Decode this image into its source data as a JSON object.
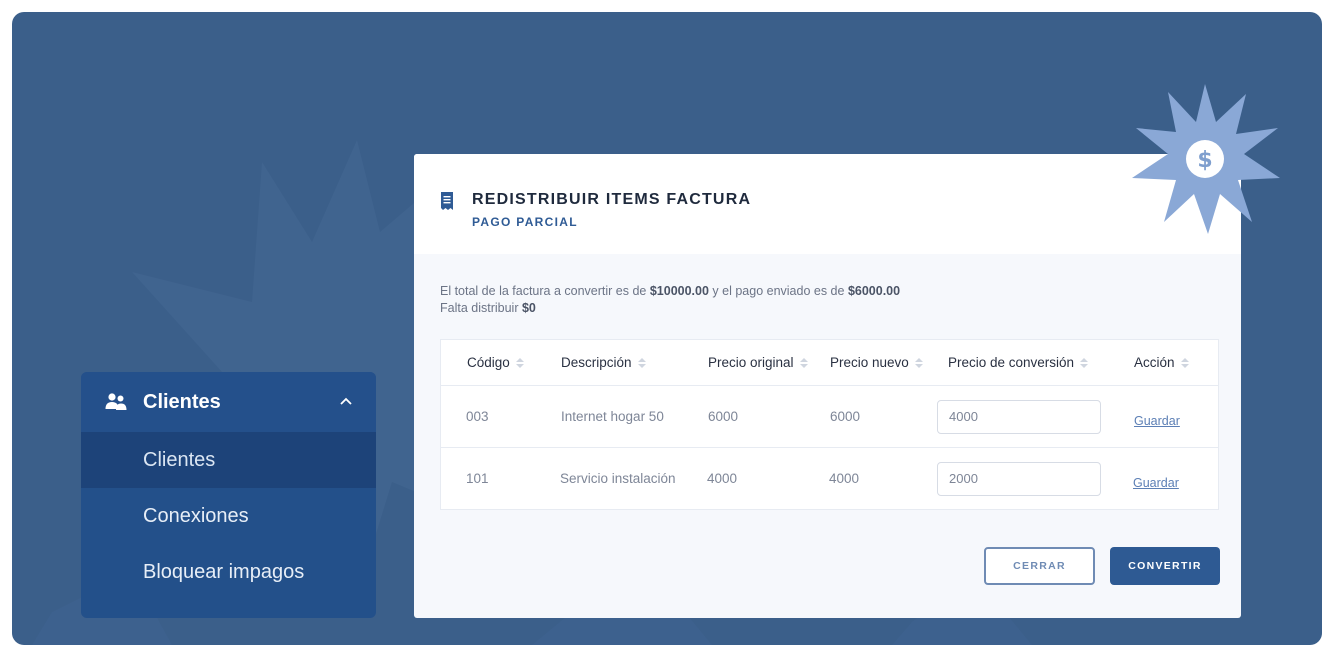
{
  "sidebar": {
    "title": "Clientes",
    "items": [
      {
        "label": "Clientes",
        "active": true
      },
      {
        "label": "Conexiones",
        "active": false
      },
      {
        "label": "Bloquear impagos",
        "active": false
      }
    ]
  },
  "modal": {
    "title": "REDISTRIBUIR ITEMS FACTURA",
    "subtitle": "PAGO PARCIAL",
    "info": {
      "line1_prefix": "El total de la factura a convertir es de ",
      "total": "$10000.00",
      "line1_mid": " y el pago enviado es de ",
      "paid": "$6000.00",
      "line2_prefix": "Falta distribuir ",
      "remaining": "$0"
    },
    "table": {
      "headers": [
        "Código",
        "Descripción",
        "Precio original",
        "Precio nuevo",
        "Precio de conversión",
        "Acción"
      ],
      "rows": [
        {
          "code": "003",
          "description": "Internet hogar 50",
          "original": "6000",
          "new": "6000",
          "conversion": "4000",
          "action": "Guardar"
        },
        {
          "code": "101",
          "description": "Servicio instalación",
          "original": "4000",
          "new": "4000",
          "conversion": "2000",
          "action": "Guardar"
        }
      ]
    },
    "buttons": {
      "close": "CERRAR",
      "convert": "CONVERTIR"
    },
    "badge_icon": "dollar-icon"
  },
  "colors": {
    "background": "#3b5f8a",
    "sidebar": "#23508a",
    "sidebar_active": "#1d4379",
    "primary": "#2e5a93",
    "badge": "#8aa8d6"
  }
}
